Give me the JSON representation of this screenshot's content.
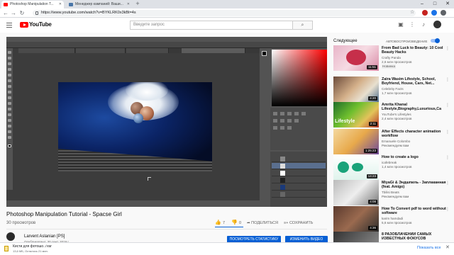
{
  "browser": {
    "tabs": [
      {
        "title": "Photoshop Manipulation T..."
      },
      {
        "title": "Менеджер кампаний: Ваши..."
      }
    ],
    "new_tab_icon": "plus-icon",
    "url": "https://www.youtube.com/watch?v=BYKLRK0x3kBt=4s",
    "window_buttons": [
      "–",
      "□",
      "✕"
    ]
  },
  "youtube": {
    "logo_text": "YouTube",
    "search_placeholder": "Введите запрос",
    "search_icon": "search-icon"
  },
  "video": {
    "title": "Photoshop Manipulation Tutorial - Spacse Girl",
    "views": "30 просмотров",
    "likes": "7",
    "dislikes": "0",
    "share_label": "ПОДЕЛИТЬСЯ",
    "save_label": "СОХРАНИТЬ",
    "channel_name": "Larvent Aslanian [PS]",
    "published": "Опубликовано: 30 сент. 2019 г.",
    "stats_button": "ПОСМОТРЕТЬ СТАТИСТИКУ",
    "edit_button": "ИЗМЕНИТЬ ВИДЕО"
  },
  "sidebar": {
    "up_next": "Следующее",
    "autoplay_label": "АВТОВОСПРОИЗВЕДЕНИЕ",
    "autoplay_on": true,
    "recommendations": [
      {
        "title": "From Bad Luck to Beauty: 10 Cool Beauty Hacks",
        "channel": "Crafty Panda",
        "meta": "2,6 млн просмотров",
        "badge": "Новинка",
        "duration": "11:51"
      },
      {
        "title": "Zaira Wasim Lifestyle, School, Boyfriend, House, Cars, Net...",
        "channel": "Celebrity Facts",
        "meta": "1,7 млн просмотров",
        "badge": "",
        "duration": "4:20"
      },
      {
        "title": "Amrita Khanal Lifestyle,Biography,Luxurious,Ca",
        "channel": "YouTube's Lifestyles",
        "meta": "2,4 млн просмотров",
        "badge": "",
        "duration": "2:11"
      },
      {
        "title": "After Effects character animation workflow",
        "channel": "Emanuele Colombo",
        "meta": "Рекомендуем вам",
        "badge": "",
        "duration": "1:25:23"
      },
      {
        "title": "How to create a logo",
        "channel": "icafebreak",
        "meta": "1,4 млн просмотров",
        "badge": "",
        "duration": "14:23"
      },
      {
        "title": "MiyaGi & Эндшпиль - Заплаканная (feat. Amigo)",
        "channel": "Tbilisi Beats",
        "meta": "Рекомендуем вам",
        "badge": "",
        "duration": "4:08"
      },
      {
        "title": "How To Convert pdf to word without software",
        "channel": "karim hamdadi",
        "meta": "5,6 млн просмотров",
        "badge": "",
        "duration": "4:36"
      },
      {
        "title": "8 РАЗОБЛАЧЕНИЙ САМЫХ ИЗВЕСТНЫХ ФОКУСОВ",
        "channel": "",
        "meta": "",
        "badge": "",
        "duration": ""
      }
    ]
  },
  "download": {
    "file_name": "Кисти для фотошо....rar",
    "status": "13,6 МБ, Осталось 21 мин.",
    "show_all": "Показать все"
  }
}
